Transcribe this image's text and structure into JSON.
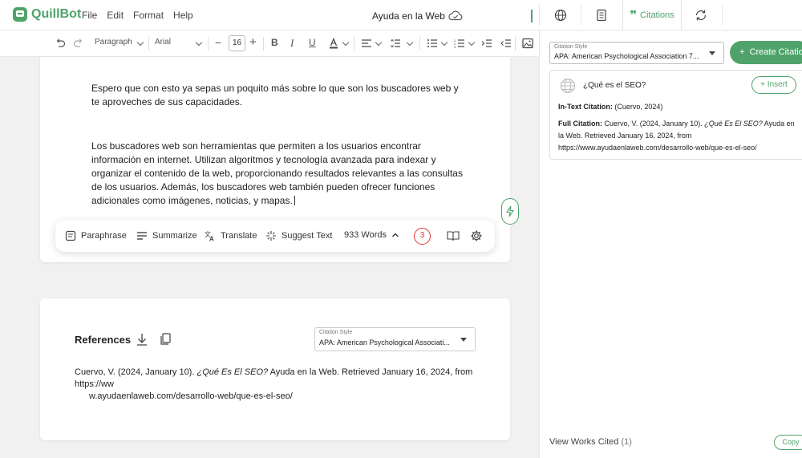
{
  "app": {
    "name": "QuillBot"
  },
  "menu": [
    "File",
    "Edit",
    "Format",
    "Help"
  ],
  "document": {
    "title": "Ayuda en la Web"
  },
  "tabs": {
    "citations_label": "Citations"
  },
  "toolbar": {
    "paragraph_style": "Paragraph",
    "font": "Arial",
    "font_size": "16",
    "bold": "B",
    "italic": "I",
    "underline": "U"
  },
  "editor": {
    "paragraphs": [
      "Espero que con esto ya sepas un poquito más sobre lo que son los buscadores web y te aproveches de sus capacidades.",
      "Los buscadores web son herramientas que permiten a los usuarios encontrar información en internet. Utilizan algoritmos y tecnología avanzada para indexar y organizar el contenido de la web, proporcionando resultados relevantes a las consultas de los usuarios. Además, los buscadores web también pueden ofrecer funciones adicionales como imágenes, noticias, y mapas."
    ]
  },
  "action_bar": {
    "paraphrase": "Paraphrase",
    "summarize": "Summarize",
    "translate": "Translate",
    "suggest_text": "Suggest Text",
    "word_count": "933 Words",
    "issues_count": "3"
  },
  "references": {
    "title": "References",
    "citation_style_label": "Citation Style",
    "citation_style_value": "APA: American Psychological Associati...",
    "entry_pre": "Cuervo, V. (2024, January 10). ",
    "entry_title": "¿Qué Es El SEO?",
    "entry_post": " Ayuda en la Web. Retrieved January 16, 2024, from https://ww",
    "entry_line2": "w.ayudaenlaweb.com/desarrollo-web/que-es-el-seo/"
  },
  "citation_panel": {
    "style_label": "Citation Style",
    "style_value": "APA: American Psychological Association 7...",
    "create_button": "Create Citation",
    "card": {
      "title": "¿Qué es el SEO?",
      "insert_label": "Insert",
      "in_text_label": "In-Text Citation:",
      "in_text_value": "(Cuervo, 2024)",
      "full_label": "Full Citation:",
      "full_pre": "Cuervo, V. (2024, January 10). ",
      "full_title": "¿Qué Es El SEO?",
      "full_post": " Ayuda en la Web. Retrieved January 16, 2024, from https://www.ayudaenlaweb.com/desarrollo-web/que-es-el-seo/"
    },
    "view_works_cited": "View Works Cited",
    "works_count": "(1)",
    "copy_label": "Copy"
  },
  "colors": {
    "brand_green": "#4fa36a",
    "issue_red": "#dd3333"
  }
}
